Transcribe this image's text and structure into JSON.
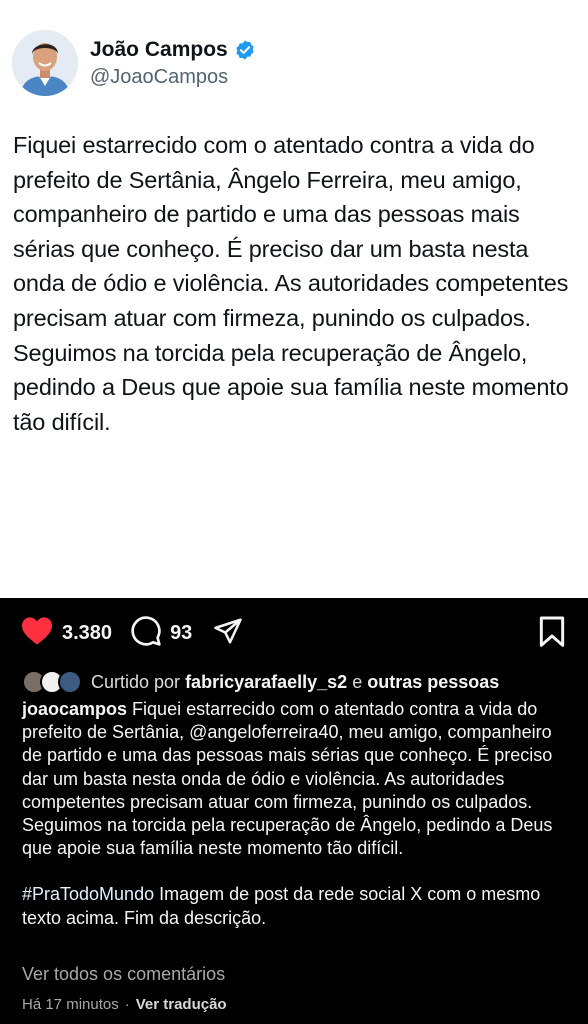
{
  "tweet": {
    "author_name": "João Campos",
    "author_handle": "@JoaoCampos",
    "verified_color": "#1d9bf0",
    "text": "Fiquei estarrecido com o atentado contra a vida do prefeito de Sertânia, Ângelo Ferreira, meu amigo, companheiro de partido e uma das pessoas mais sérias que conheço. É preciso dar um basta nesta onda de ódio e violência. As autoridades competentes precisam atuar com firmeza, punindo os culpados. Seguimos na torcida pela recuperação de Ângelo, pedindo a Deus que apoie sua família neste momento tão difícil."
  },
  "post": {
    "likes_count": "3.380",
    "comments_count": "93",
    "like_color": "#ff3040",
    "icons": [
      "heart-icon",
      "comment-icon",
      "share-icon",
      "bookmark-icon"
    ],
    "liked_by": {
      "prefix": "Curtido por",
      "user": "fabricyarafaelly_s2",
      "connector": "e",
      "others": "outras pessoas"
    },
    "caption": {
      "username": "joaocampos",
      "text_before_mention": "Fiquei estarrecido com o atentado contra a vida do prefeito de Sertânia,",
      "mention": "@angeloferreira40",
      "text_after_mention": ", meu amigo, companheiro de partido e uma das pessoas mais sérias que conheço. É preciso dar um basta nesta onda de ódio e violência. As autoridades competentes precisam atuar com firmeza, punindo os culpados. Seguimos na torcida pela recuperação de Ângelo, pedindo a Deus que apoie sua família neste momento tão difícil.",
      "hashtag": "#PraTodoMundo",
      "alt_description": "Imagem de post da rede social X com o mesmo texto acima. Fim da descrição."
    },
    "view_comments": "Ver todos os comentários",
    "time_ago": "Há 17 minutos",
    "separator": "·",
    "see_translation": "Ver tradução"
  }
}
